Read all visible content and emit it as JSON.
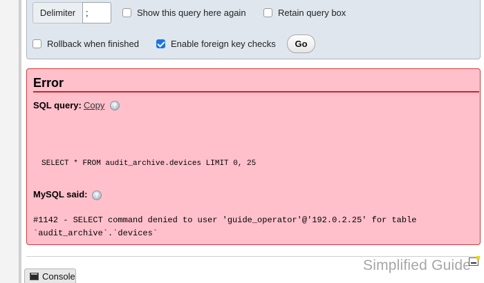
{
  "options": {
    "delimiter_label": "Delimiter",
    "delimiter_value": ";",
    "show_query_label": "Show this query here again",
    "retain_query_label": "Retain query box",
    "rollback_label": "Rollback when finished",
    "foreign_key_label": "Enable foreign key checks",
    "go_label": "Go"
  },
  "error": {
    "title": "Error",
    "sql_query_label": "SQL query:",
    "copy_label": "Copy",
    "sql_text": "SELECT * FROM audit_archive.devices LIMIT 0, 25",
    "mysql_said_label": "MySQL said:",
    "message": "#1142 - SELECT command denied to user 'guide_operator'@'192.0.2.25' for table\n`audit_archive`.`devices`"
  },
  "footer": {
    "console_label": "Console",
    "watermark": "Simplified Guide"
  },
  "colors": {
    "error_background": "#ffc0cb",
    "error_rule": "#d02222",
    "options_background": "#dfe6ee",
    "checkbox_checked": "#1a73e8"
  }
}
